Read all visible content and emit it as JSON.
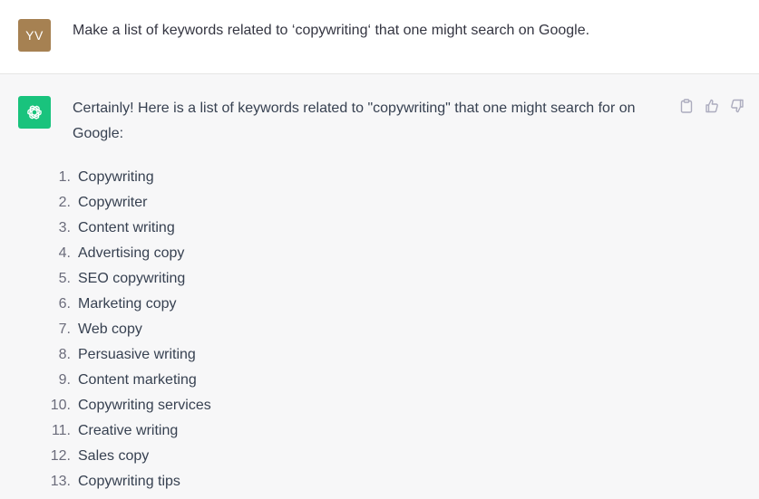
{
  "user": {
    "avatar_initials": "YV",
    "avatar_color": "#a68152",
    "message": "Make a list of keywords related to ‘copywriting‘ that one might search on Google."
  },
  "assistant": {
    "avatar_icon": "openai-logo-icon",
    "avatar_color": "#19c37d",
    "intro": "Certainly! Here is a list of keywords related to \"copywriting\" that one might search for on Google:",
    "keywords": [
      {
        "num": "1.",
        "label": "Copywriting"
      },
      {
        "num": "2.",
        "label": "Copywriter"
      },
      {
        "num": "3.",
        "label": "Content writing"
      },
      {
        "num": "4.",
        "label": "Advertising copy"
      },
      {
        "num": "5.",
        "label": "SEO copywriting"
      },
      {
        "num": "6.",
        "label": "Marketing copy"
      },
      {
        "num": "7.",
        "label": "Web copy"
      },
      {
        "num": "8.",
        "label": "Persuasive writing"
      },
      {
        "num": "9.",
        "label": "Content marketing"
      },
      {
        "num": "10.",
        "label": "Copywriting services"
      },
      {
        "num": "11.",
        "label": "Creative writing"
      },
      {
        "num": "12.",
        "label": "Sales copy"
      },
      {
        "num": "13.",
        "label": "Copywriting tips"
      }
    ]
  },
  "actions": {
    "copy_icon": "clipboard-icon",
    "like_icon": "thumbs-up-icon",
    "dislike_icon": "thumbs-down-icon"
  }
}
